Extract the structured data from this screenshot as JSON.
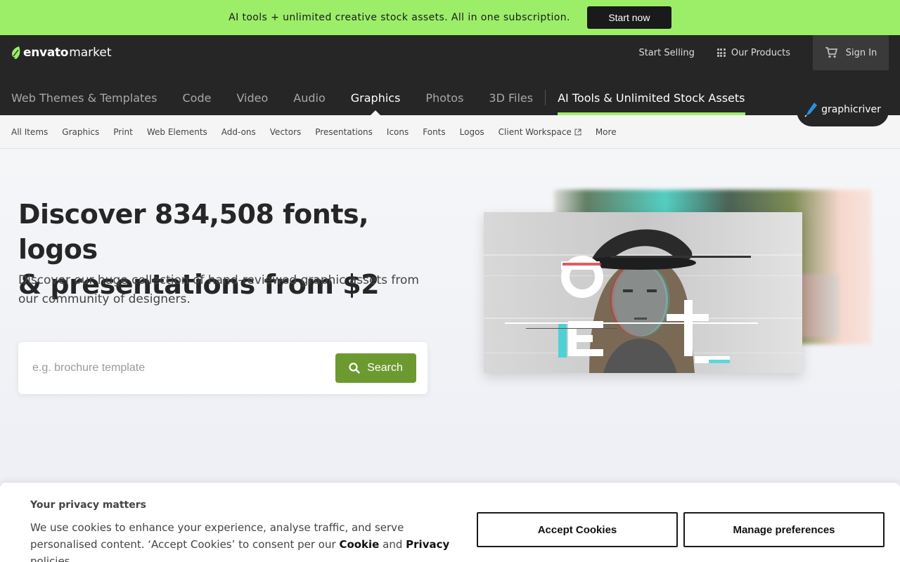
{
  "promo": {
    "text": "AI tools + unlimited creative stock assets. All in one subscription.",
    "button": "Start now"
  },
  "header": {
    "logo_envato": "envato",
    "logo_market": "market",
    "start_selling": "Start Selling",
    "our_products": "Our Products",
    "sign_in": "Sign In",
    "site_badge": "graphicriver"
  },
  "main_nav": {
    "items": [
      "Web Themes & Templates",
      "Code",
      "Video",
      "Audio",
      "Graphics",
      "Photos",
      "3D Files"
    ],
    "active": "Graphics",
    "ai_item": "AI Tools & Unlimited Stock Assets"
  },
  "sub_nav": {
    "items": [
      "All Items",
      "Graphics",
      "Print",
      "Web Elements",
      "Add-ons",
      "Vectors",
      "Presentations",
      "Icons",
      "Fonts",
      "Logos",
      "Client Workspace",
      "More"
    ]
  },
  "hero": {
    "title_line1": "Discover 834,508 fonts, logos",
    "title_line2": "& presentations from $2",
    "subtitle": "Discover our huge collection of hand-reviewed graphic assets from our community of designers.",
    "search_placeholder": "e.g. brochure template",
    "search_button": "Search"
  },
  "cookie": {
    "title": "Your privacy matters",
    "text_before": "We use cookies to enhance your experience, analyse traffic, and serve personalised content. ‘Accept Cookies’ to consent per our",
    "cookie_link": "Cookie",
    "and": "and",
    "privacy_link": "Privacy",
    "text_after": "policies.",
    "accept": "Accept Cookies",
    "manage": "Manage preferences"
  },
  "colors": {
    "promo_bg": "#9cee69",
    "header_bg": "#262626",
    "search_button": "#6c9a30",
    "ai_underline": "#9cee69"
  },
  "icons": [
    "leaf-logo-icon",
    "grid-icon",
    "cart-icon",
    "pen-icon",
    "search-icon",
    "external-link-icon"
  ]
}
